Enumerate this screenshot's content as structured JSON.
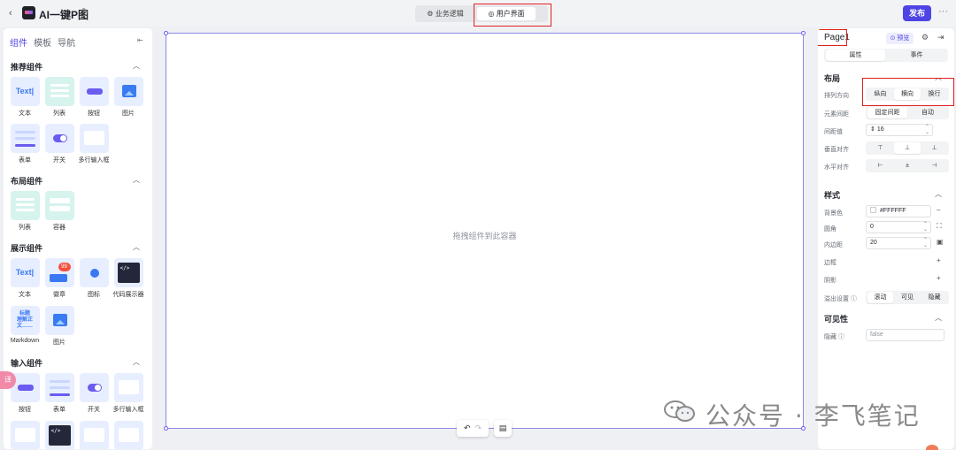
{
  "header": {
    "back_icon": "‹",
    "app_title": "AI一键P图",
    "tabs": [
      {
        "label": "⚙ 业务逻辑"
      },
      {
        "label": "◎ 用户界面"
      }
    ],
    "publish_label": "发布",
    "more_icon": "···"
  },
  "left_panel": {
    "tabs": [
      "组件",
      "模板",
      "导航"
    ],
    "sections": [
      {
        "title": "推荐组件",
        "items": [
          "文本",
          "列表",
          "按钮",
          "图片",
          "表单",
          "开关",
          "多行输入框"
        ]
      },
      {
        "title": "布局组件",
        "items": [
          "列表",
          "容器"
        ]
      },
      {
        "title": "展示组件",
        "items": [
          "文本",
          "徽章",
          "图标",
          "代码展示器",
          "Markdown",
          "图片"
        ]
      },
      {
        "title": "输入组件",
        "items": [
          "按钮",
          "表单",
          "开关",
          "多行输入框"
        ]
      }
    ],
    "tile_text": "Text|",
    "badge_value": "99",
    "markdown_tile": "标题\n理解正\n文……",
    "float_label": "译"
  },
  "canvas": {
    "drop_hint": "拖拽组件到此容器",
    "undo_icon": "↶",
    "redo_icon": "↷",
    "doc_icon": "▤"
  },
  "right_panel": {
    "page_name": "Page1",
    "preview_label": "⊙ 预览",
    "tabs": [
      "属性",
      "事件"
    ],
    "layout": {
      "title": "布局",
      "direction_label": "排列方向",
      "direction_options": [
        "纵向",
        "横向",
        "换行"
      ],
      "spacing_label": "元素间距",
      "spacing_options": [
        "固定间距",
        "自动"
      ],
      "gap_label": "间距值",
      "gap_value": "16",
      "valign_label": "垂直对齐",
      "halign_label": "水平对齐"
    },
    "style": {
      "title": "样式",
      "bg_label": "背景色",
      "bg_value": "#FFFFFF",
      "radius_label": "圆角",
      "radius_value": "0",
      "padding_label": "内边距",
      "padding_value": "20",
      "border_label": "边框",
      "shadow_label": "阴影",
      "overflow_label": "溢出设置 ⓘ",
      "overflow_options": [
        "滚动",
        "可见",
        "隐藏"
      ]
    },
    "visibility": {
      "title": "可见性",
      "hidden_label": "隐藏 ⓘ",
      "hidden_value": "false"
    }
  },
  "watermark": {
    "text": "公众号 · 李飞笔记"
  },
  "colors": {
    "accent": "#4e44e6",
    "highlight_box": "#e02020",
    "canvas_border": "#8c86e8"
  }
}
